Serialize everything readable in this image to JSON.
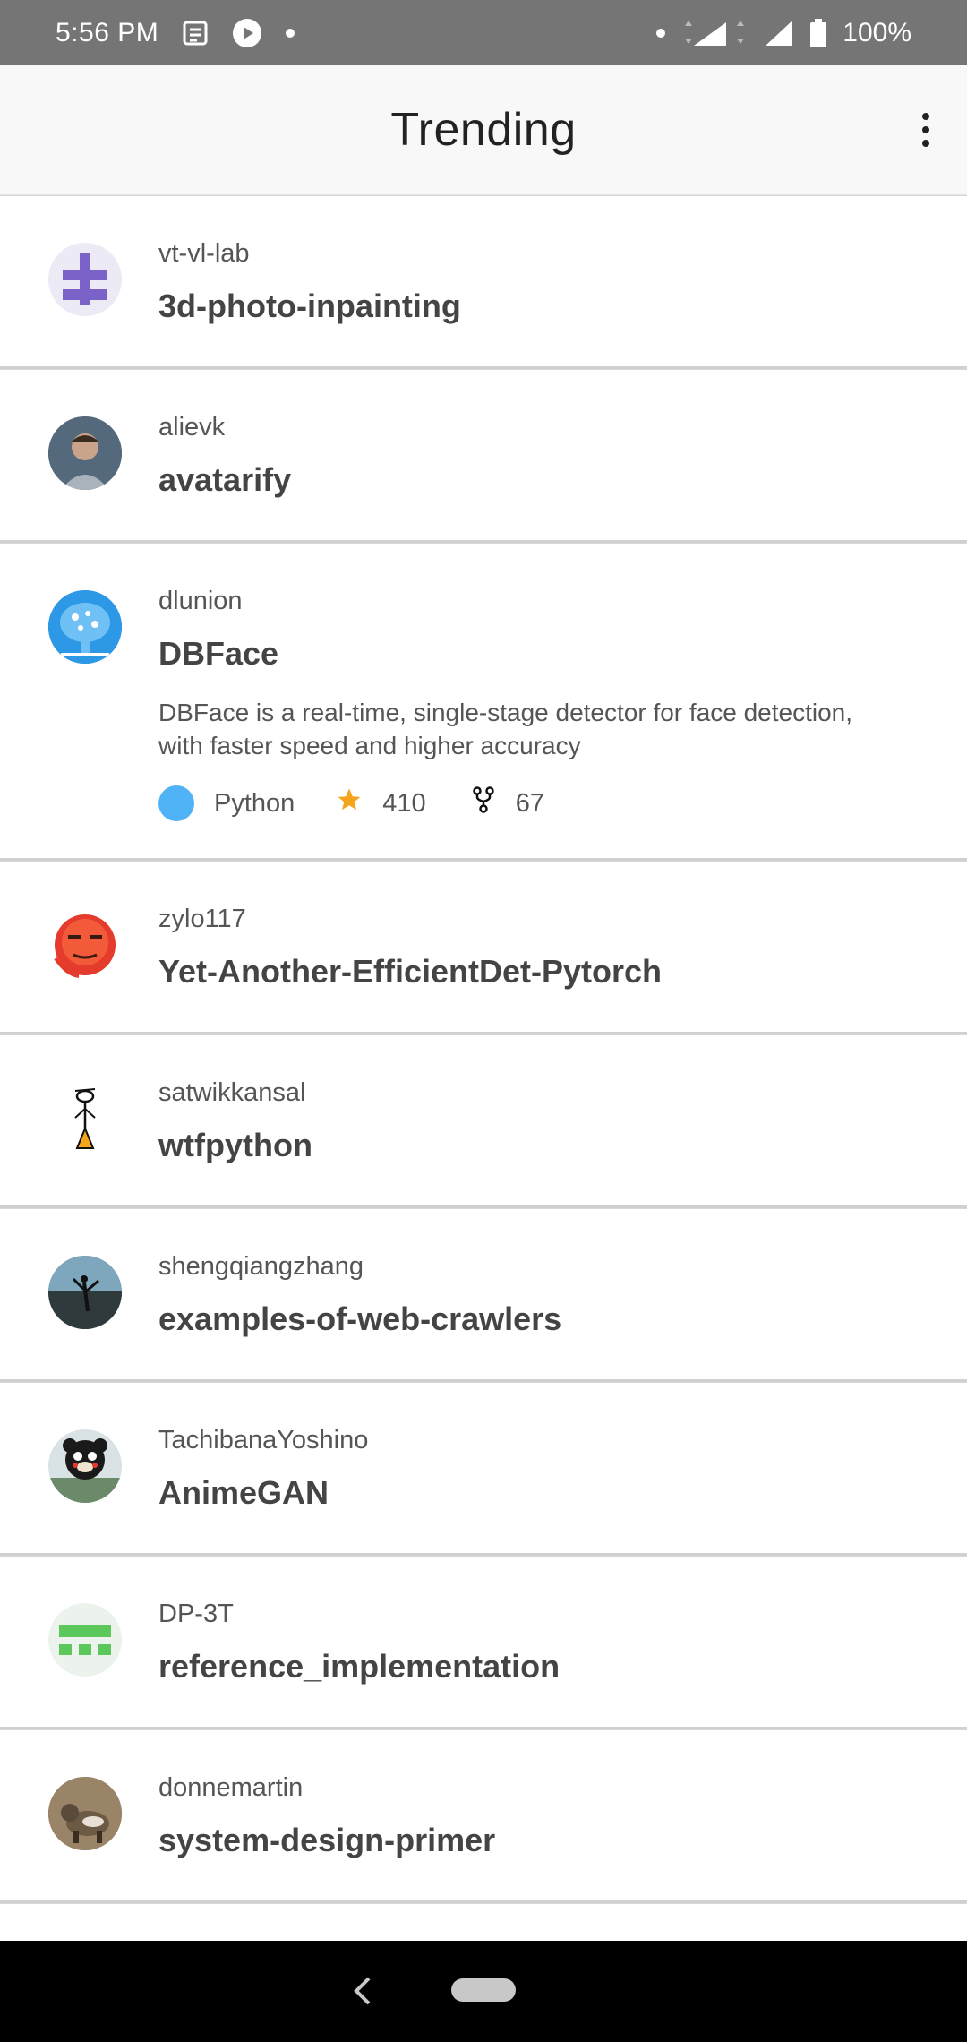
{
  "status_bar": {
    "time": "5:56 PM",
    "network": "4G",
    "battery": "100%"
  },
  "app_bar": {
    "title": "Trending"
  },
  "repos": [
    {
      "owner": "vt-vl-lab",
      "name": "3d-photo-inpainting",
      "avatar": "lab-logo-icon"
    },
    {
      "owner": "alievk",
      "name": "avatarify",
      "avatar": "user-photo-icon"
    },
    {
      "owner": "dlunion",
      "name": "DBFace",
      "avatar": "brain-logo-icon",
      "description": "DBFace is a real-time, single-stage detector for face detection, with faster speed and higher accuracy",
      "language": "Python",
      "language_color": "#4fb3f6",
      "stars": "410",
      "forks": "67"
    },
    {
      "owner": "zylo117",
      "name": "Yet-Another-EfficientDet-Pytorch",
      "avatar": "face-emoji-icon"
    },
    {
      "owner": "satwikkansal",
      "name": "wtfpython",
      "avatar": "stick-figure-icon"
    },
    {
      "owner": "shengqiangzhang",
      "name": "examples-of-web-crawlers",
      "avatar": "beach-photo-icon"
    },
    {
      "owner": "TachibanaYoshino",
      "name": "AnimeGAN",
      "avatar": "bear-photo-icon"
    },
    {
      "owner": "DP-3T",
      "name": "reference_implementation",
      "avatar": "identicon-icon"
    },
    {
      "owner": "donnemartin",
      "name": "system-design-primer",
      "avatar": "animal-photo-icon"
    }
  ]
}
